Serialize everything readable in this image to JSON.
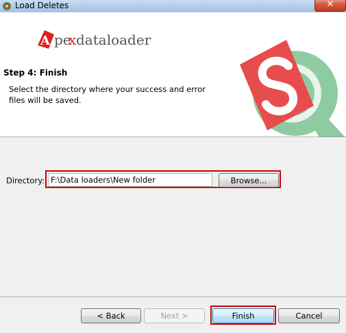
{
  "window": {
    "title": "Load Deletes",
    "close_label": "✕"
  },
  "header": {
    "logo_text": "Apexdataloader",
    "step_title": "Step 4: Finish",
    "step_description": "Select the directory where your success and error files will be saved."
  },
  "directory": {
    "label": "Directory:",
    "value": "F:\\Data loaders\\New folder",
    "browse_label": "Browse..."
  },
  "footer": {
    "back_label": "< Back",
    "next_label": "Next >",
    "finish_label": "Finish",
    "cancel_label": "Cancel"
  },
  "colors": {
    "highlight": "#cc0000",
    "logo_red": "#e02020",
    "logo_green": "#7fbf8f"
  },
  "icons": [
    "app-icon",
    "apex-logo",
    "sr-logo-graphic",
    "close-icon"
  ]
}
